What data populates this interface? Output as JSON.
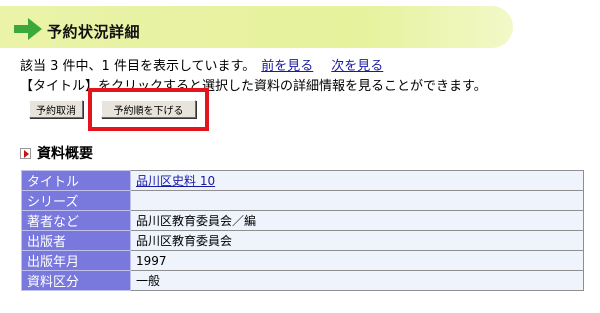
{
  "header": {
    "title": "予約状況詳細"
  },
  "nav": {
    "status_text": "該当 3 件中、1 件目を表示しています。",
    "prev_label": "前を見る",
    "next_label": "次を見る"
  },
  "instruction": "【タイトル】をクリックすると選択した資料の詳細情報を見ることができます。",
  "buttons": {
    "cancel_label": "予約取消",
    "lower_label": "予約順を下げる"
  },
  "section": {
    "title": "資料概要"
  },
  "details": {
    "rows": [
      {
        "label": "タイトル",
        "value": "品川区史料 10"
      },
      {
        "label": "シリーズ",
        "value": ""
      },
      {
        "label": "著者など",
        "value": "品川区教育委員会／編"
      },
      {
        "label": "出版者",
        "value": "品川区教育委員会"
      },
      {
        "label": "出版年月",
        "value": "1997"
      },
      {
        "label": "資料区分",
        "value": "一般"
      }
    ]
  },
  "colors": {
    "banner": "#e6f29c",
    "label_bg": "#7878dd",
    "value_bg": "#eef3fc",
    "highlight": "#e4141c",
    "link": "#1a1aa6"
  }
}
